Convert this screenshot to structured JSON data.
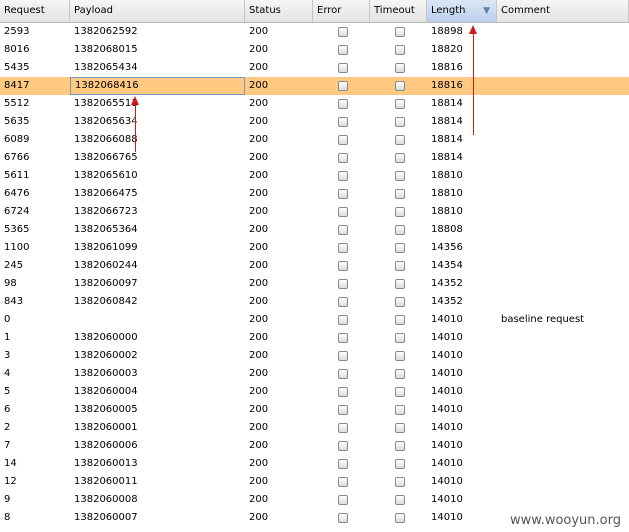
{
  "columns": [
    "Request",
    "Payload",
    "Status",
    "Error",
    "Timeout",
    "Length",
    "Comment"
  ],
  "sorted_column": "Length",
  "sort_indicator": "▼",
  "selected_row": 3,
  "colors": {
    "selection": "#ffc982",
    "annotation_arrow": "#d01818",
    "sorted_header": "#bcd1ee"
  },
  "rows": [
    {
      "request": "2593",
      "payload": "1382062592",
      "status": "200",
      "length": "18898",
      "comment": ""
    },
    {
      "request": "8016",
      "payload": "1382068015",
      "status": "200",
      "length": "18820",
      "comment": ""
    },
    {
      "request": "5435",
      "payload": "1382065434",
      "status": "200",
      "length": "18816",
      "comment": ""
    },
    {
      "request": "8417",
      "payload": "1382068416",
      "status": "200",
      "length": "18816",
      "comment": ""
    },
    {
      "request": "5512",
      "payload": "1382065511",
      "status": "200",
      "length": "18814",
      "comment": ""
    },
    {
      "request": "5635",
      "payload": "1382065634",
      "status": "200",
      "length": "18814",
      "comment": ""
    },
    {
      "request": "6089",
      "payload": "1382066088",
      "status": "200",
      "length": "18814",
      "comment": ""
    },
    {
      "request": "6766",
      "payload": "1382066765",
      "status": "200",
      "length": "18814",
      "comment": ""
    },
    {
      "request": "5611",
      "payload": "1382065610",
      "status": "200",
      "length": "18810",
      "comment": ""
    },
    {
      "request": "6476",
      "payload": "1382066475",
      "status": "200",
      "length": "18810",
      "comment": ""
    },
    {
      "request": "6724",
      "payload": "1382066723",
      "status": "200",
      "length": "18810",
      "comment": ""
    },
    {
      "request": "5365",
      "payload": "1382065364",
      "status": "200",
      "length": "18808",
      "comment": ""
    },
    {
      "request": "1100",
      "payload": "1382061099",
      "status": "200",
      "length": "14356",
      "comment": ""
    },
    {
      "request": "245",
      "payload": "1382060244",
      "status": "200",
      "length": "14354",
      "comment": ""
    },
    {
      "request": "98",
      "payload": "1382060097",
      "status": "200",
      "length": "14352",
      "comment": ""
    },
    {
      "request": "843",
      "payload": "1382060842",
      "status": "200",
      "length": "14352",
      "comment": ""
    },
    {
      "request": "0",
      "payload": "",
      "status": "200",
      "length": "14010",
      "comment": "baseline request"
    },
    {
      "request": "1",
      "payload": "1382060000",
      "status": "200",
      "length": "14010",
      "comment": ""
    },
    {
      "request": "3",
      "payload": "1382060002",
      "status": "200",
      "length": "14010",
      "comment": ""
    },
    {
      "request": "4",
      "payload": "1382060003",
      "status": "200",
      "length": "14010",
      "comment": ""
    },
    {
      "request": "5",
      "payload": "1382060004",
      "status": "200",
      "length": "14010",
      "comment": ""
    },
    {
      "request": "6",
      "payload": "1382060005",
      "status": "200",
      "length": "14010",
      "comment": ""
    },
    {
      "request": "2",
      "payload": "1382060001",
      "status": "200",
      "length": "14010",
      "comment": ""
    },
    {
      "request": "7",
      "payload": "1382060006",
      "status": "200",
      "length": "14010",
      "comment": ""
    },
    {
      "request": "14",
      "payload": "1382060013",
      "status": "200",
      "length": "14010",
      "comment": ""
    },
    {
      "request": "12",
      "payload": "1382060011",
      "status": "200",
      "length": "14010",
      "comment": ""
    },
    {
      "request": "9",
      "payload": "1382060008",
      "status": "200",
      "length": "14010",
      "comment": ""
    },
    {
      "request": "8",
      "payload": "1382060007",
      "status": "200",
      "length": "14010",
      "comment": ""
    }
  ],
  "watermark": "www.wooyun.org"
}
